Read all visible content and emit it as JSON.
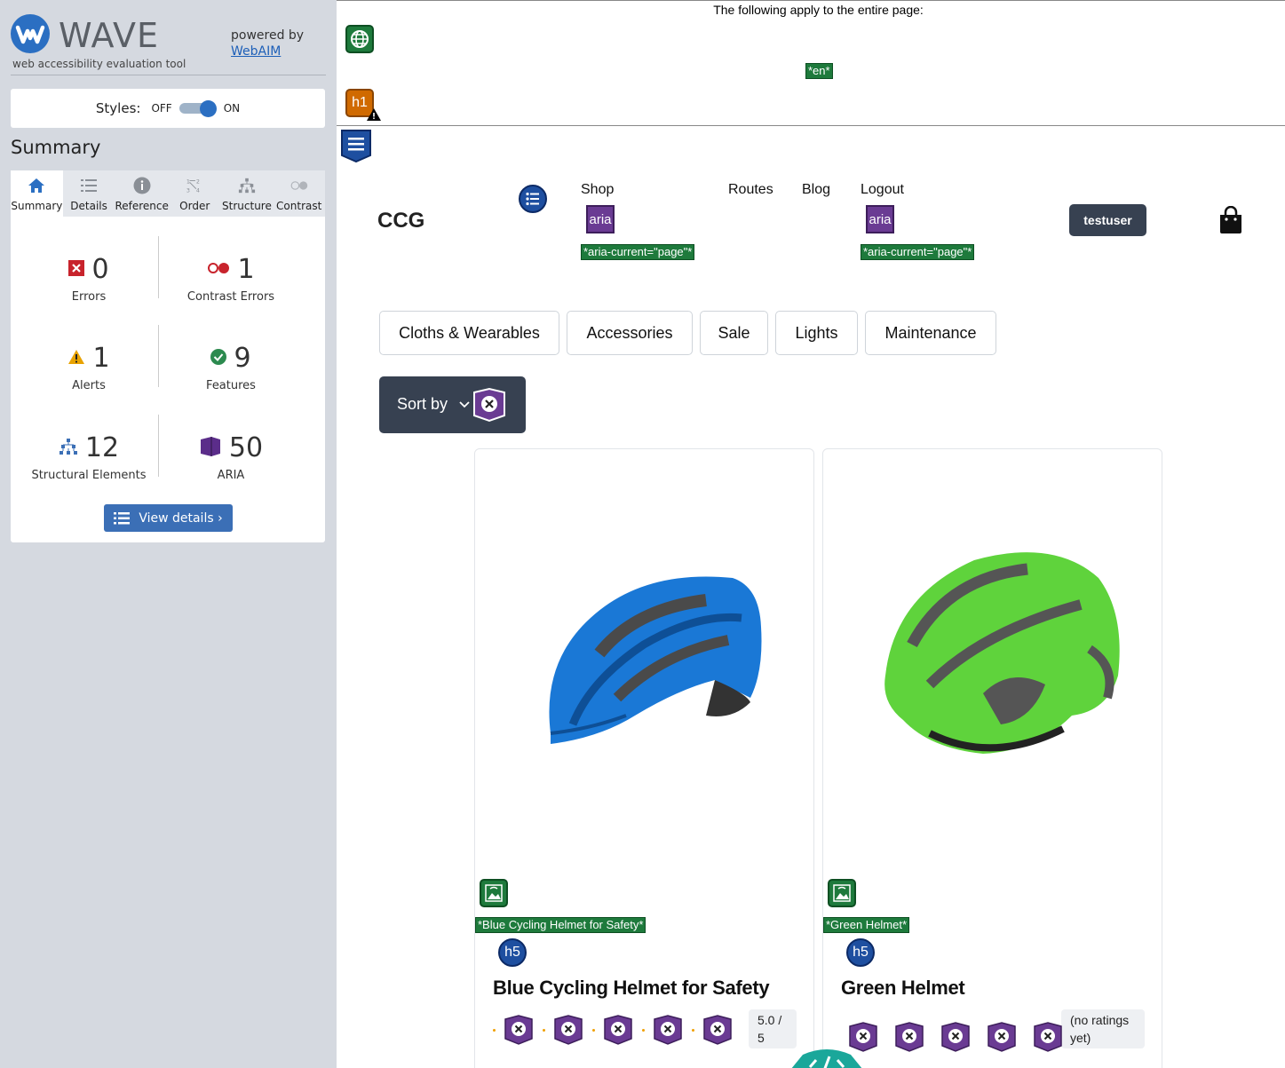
{
  "wave": {
    "title": "WAVE",
    "subtitle": "web accessibility evaluation tool",
    "powered_by": "powered by",
    "webaim_link": "WebAIM",
    "styles_label": "Styles:",
    "styles_off": "OFF",
    "styles_on": "ON",
    "summary_heading": "Summary",
    "tabs": [
      {
        "label": "Summary",
        "icon": "home-icon"
      },
      {
        "label": "Details",
        "icon": "list-icon"
      },
      {
        "label": "Reference",
        "icon": "info-icon"
      },
      {
        "label": "Order",
        "icon": "order-icon"
      },
      {
        "label": "Structure",
        "icon": "structure-icon"
      },
      {
        "label": "Contrast",
        "icon": "contrast-icon"
      }
    ],
    "stats": {
      "errors": {
        "value": "0",
        "label": "Errors"
      },
      "contrast": {
        "value": "1",
        "label": "Contrast Errors"
      },
      "alerts": {
        "value": "1",
        "label": "Alerts"
      },
      "features": {
        "value": "9",
        "label": "Features"
      },
      "structural": {
        "value": "12",
        "label": "Structural Elements"
      },
      "aria": {
        "value": "50",
        "label": "ARIA"
      }
    },
    "view_details": "View details ›"
  },
  "page": {
    "note": "The following apply to the entire page:",
    "lang_tag": "*en*",
    "h1_label": "h1",
    "brand": "CCG",
    "nav": {
      "shop": "Shop",
      "routes": "Routes",
      "blog": "Blog",
      "logout": "Logout"
    },
    "aria_label": "aria",
    "aria_current_tag": "*aria-current=\"page\"*",
    "user": "testuser",
    "categories": [
      "Cloths & Wearables",
      "Accessories",
      "Sale",
      "Lights",
      "Maintenance"
    ],
    "sort_by": "Sort by",
    "h5_label": "h5",
    "products": [
      {
        "alt_tag": "*Blue Cycling Helmet for Safety*",
        "name": "Blue Cycling Helmet for Safety",
        "rating": "5.0 / 5",
        "color": "#1a78d6"
      },
      {
        "alt_tag": "*Green Helmet*",
        "name": "Green Helmet",
        "rating": "(no ratings yet)",
        "color": "#5fd33c"
      }
    ]
  },
  "colors": {
    "sidebar_bg": "#d5d9e0",
    "wave_blue": "#2b6fc2",
    "error_red": "#c8232c",
    "alert_orange": "#e8a200",
    "feature_green": "#2c8a4f",
    "aria_purple": "#6a3b93",
    "dark_button": "#374151"
  }
}
